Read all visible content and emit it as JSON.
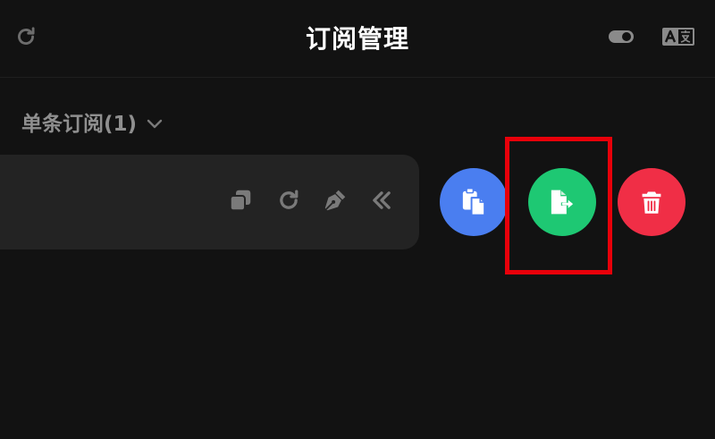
{
  "header": {
    "title": "订阅管理",
    "refresh_icon": "refresh-icon",
    "toggle_icon": "toggle-icon",
    "translate_icon": "translate-icon"
  },
  "section": {
    "title": "单条订阅(1)",
    "chevron_icon": "chevron-down-icon"
  },
  "card_actions": [
    {
      "icon": "copy-icon"
    },
    {
      "icon": "refresh-icon"
    },
    {
      "icon": "pen-icon"
    },
    {
      "icon": "double-chevron-left-icon"
    }
  ],
  "round_actions": [
    {
      "icon": "clipboard-icon",
      "color": "#4a7ef0"
    },
    {
      "icon": "file-export-icon",
      "color": "#1ec873"
    },
    {
      "icon": "trash-icon",
      "color": "#f02e46"
    }
  ],
  "colors": {
    "background": "#121212",
    "card": "#232323",
    "highlight": "#e8000a"
  }
}
